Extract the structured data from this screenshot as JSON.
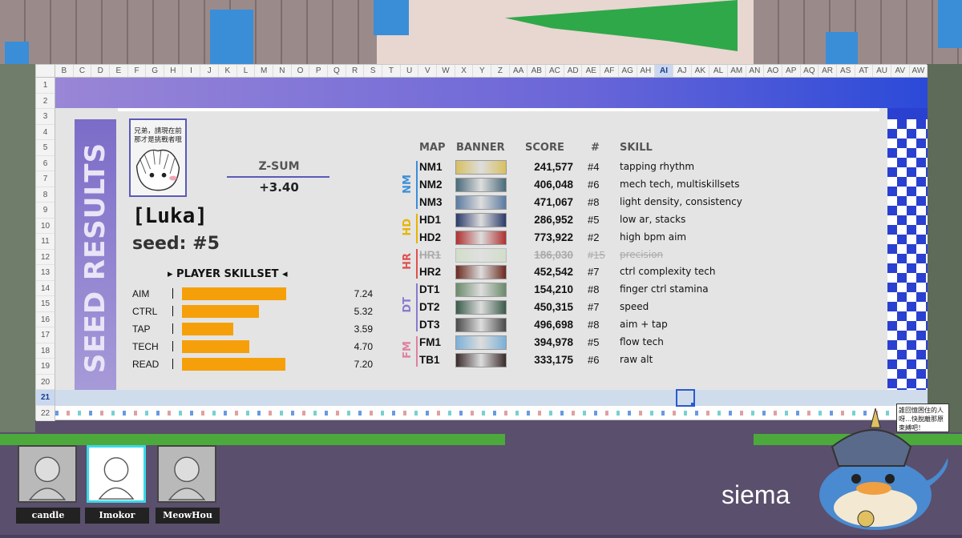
{
  "sheet": {
    "columns": [
      "B",
      "C",
      "D",
      "E",
      "F",
      "G",
      "H",
      "I",
      "J",
      "K",
      "L",
      "M",
      "N",
      "O",
      "P",
      "Q",
      "R",
      "S",
      "T",
      "U",
      "V",
      "W",
      "X",
      "Y",
      "Z",
      "AA",
      "AB",
      "AC",
      "AD",
      "AE",
      "AF",
      "AG",
      "AH",
      "AI",
      "AJ",
      "AK",
      "AL",
      "AM",
      "AN",
      "AO",
      "AP",
      "AQ",
      "AR",
      "AS",
      "AT",
      "AU",
      "AV",
      "AW"
    ],
    "selected_column": "AI",
    "rows": [
      "1",
      "2",
      "3",
      "4",
      "5",
      "6",
      "7",
      "8",
      "9",
      "10",
      "11",
      "12",
      "13",
      "14",
      "15",
      "16",
      "17",
      "18",
      "19",
      "20",
      "21",
      "22"
    ],
    "selected_row": "21"
  },
  "card": {
    "side_title": "SEED RESULTS",
    "avatar_text": "兄弟，請現在前\n那才是挑戰者哦",
    "zsum_label": "Z-SUM",
    "zsum_value": "+3.40",
    "player_name": "[Luka]",
    "seed": "seed: #5",
    "skillset_title": "▸ PLAYER SKILLSET ◂",
    "skills": [
      {
        "name": "AIM",
        "value": "7.24",
        "level": 7.24
      },
      {
        "name": "CTRL",
        "value": "5.32",
        "level": 5.32
      },
      {
        "name": "TAP",
        "value": "3.59",
        "level": 3.59
      },
      {
        "name": "TECH",
        "value": "4.70",
        "level": 4.7
      },
      {
        "name": "READ",
        "value": "7.20",
        "level": 7.2
      }
    ]
  },
  "table": {
    "headers": {
      "map": "MAP",
      "banner": "BANNER",
      "score": "SCORE",
      "rank": "#",
      "skill": "SKILL"
    },
    "mods": [
      {
        "label": "NM",
        "color": "#3a8ed8"
      },
      {
        "label": "HD",
        "color": "#e8b400"
      },
      {
        "label": "HR",
        "color": "#e05050"
      },
      {
        "label": "DT",
        "color": "#8a7ad0"
      },
      {
        "label": "FM",
        "color": "#e080a0"
      }
    ],
    "rows": [
      {
        "map": "NM1",
        "score": "241,577",
        "rank": "#4",
        "skill": "tapping rhythm",
        "banner": "#d8c060",
        "struck": false
      },
      {
        "map": "NM2",
        "score": "406,048",
        "rank": "#6",
        "skill": "mech tech, multiskillsets",
        "banner": "#4a6a7a",
        "struck": false
      },
      {
        "map": "NM3",
        "score": "471,067",
        "rank": "#8",
        "skill": "light density, consistency",
        "banner": "#5a7aa0",
        "struck": false
      },
      {
        "map": "HD1",
        "score": "286,952",
        "rank": "#5",
        "skill": "low ar, stacks",
        "banner": "#2a3a6a",
        "struck": false
      },
      {
        "map": "HD2",
        "score": "773,922",
        "rank": "#2",
        "skill": "high bpm aim",
        "banner": "#b03030",
        "struck": false
      },
      {
        "map": "HR1",
        "score": "186,030",
        "rank": "#15",
        "skill": "precision",
        "banner": "#c0d8b0",
        "struck": true
      },
      {
        "map": "HR2",
        "score": "452,542",
        "rank": "#7",
        "skill": "ctrl complexity tech",
        "banner": "#6a2a20",
        "struck": false
      },
      {
        "map": "DT1",
        "score": "154,210",
        "rank": "#8",
        "skill": "finger ctrl stamina",
        "banner": "#6a8a6a",
        "struck": false
      },
      {
        "map": "DT2",
        "score": "450,315",
        "rank": "#7",
        "skill": "speed",
        "banner": "#3a5a4a",
        "struck": false
      },
      {
        "map": "DT3",
        "score": "496,698",
        "rank": "#8",
        "skill": "aim + tap",
        "banner": "#4a4a4a",
        "struck": false
      },
      {
        "map": "FM1",
        "score": "394,978",
        "rank": "#5",
        "skill": "flow tech",
        "banner": "#7ab0d8",
        "struck": false
      },
      {
        "map": "TB1",
        "score": "333,175",
        "rank": "#6",
        "skill": "raw alt",
        "banner": "#3a2a2a",
        "struck": false
      }
    ]
  },
  "players": [
    {
      "name": "candle",
      "active": false
    },
    {
      "name": "Imokor",
      "active": true
    },
    {
      "name": "MeowHou",
      "active": false
    }
  ],
  "overlay_text": "siema",
  "speech_bubble": "誰回憶困住的人呀…快脫離那原束縛吧！",
  "colors": {
    "accent": "#2a40d0",
    "bar": "#f5a00a",
    "side": "#7b6cc8"
  }
}
